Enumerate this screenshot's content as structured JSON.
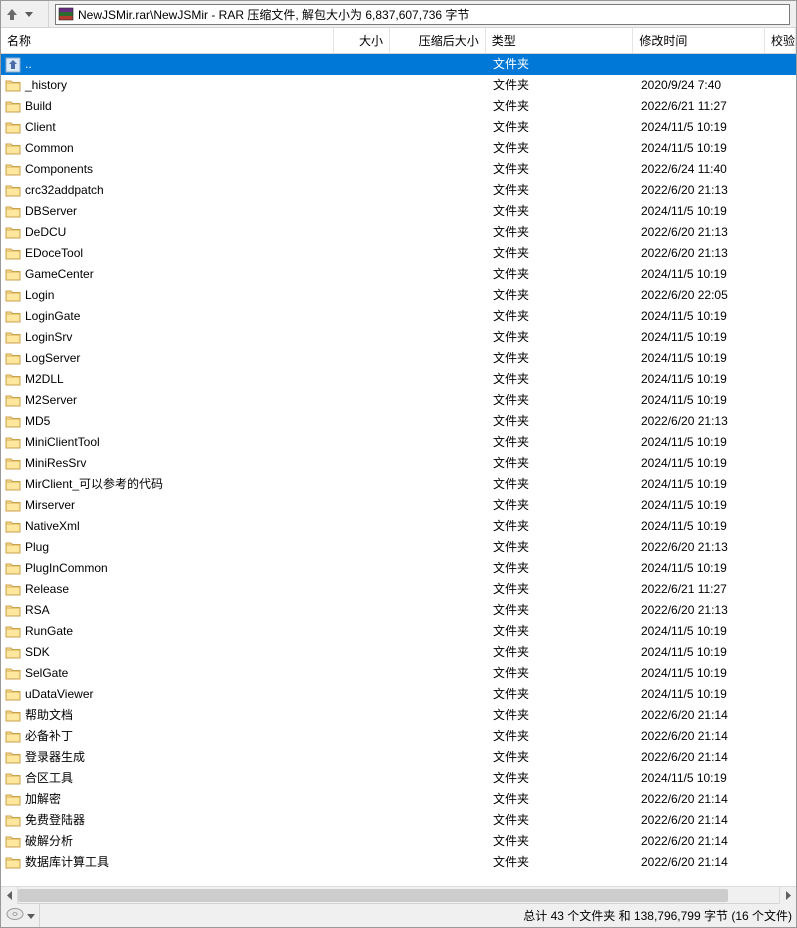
{
  "path": {
    "text": "NewJSMir.rar\\NewJSMir - RAR 压缩文件, 解包大小为 6,837,607,736 字节"
  },
  "columns": {
    "name": "名称",
    "size": "大小",
    "packed": "压缩后大小",
    "type": "类型",
    "mtime": "修改时间",
    "crc": "校验"
  },
  "parent_row": {
    "name": "..",
    "type": "文件夹"
  },
  "rows": [
    {
      "name": "_history",
      "type": "文件夹",
      "mtime": "2020/9/24 7:40"
    },
    {
      "name": "Build",
      "type": "文件夹",
      "mtime": "2022/6/21 11:27"
    },
    {
      "name": "Client",
      "type": "文件夹",
      "mtime": "2024/11/5 10:19"
    },
    {
      "name": "Common",
      "type": "文件夹",
      "mtime": "2024/11/5 10:19"
    },
    {
      "name": "Components",
      "type": "文件夹",
      "mtime": "2022/6/24 11:40"
    },
    {
      "name": "crc32addpatch",
      "type": "文件夹",
      "mtime": "2022/6/20 21:13"
    },
    {
      "name": "DBServer",
      "type": "文件夹",
      "mtime": "2024/11/5 10:19"
    },
    {
      "name": "DeDCU",
      "type": "文件夹",
      "mtime": "2022/6/20 21:13"
    },
    {
      "name": "EDoceTool",
      "type": "文件夹",
      "mtime": "2022/6/20 21:13"
    },
    {
      "name": "GameCenter",
      "type": "文件夹",
      "mtime": "2024/11/5 10:19"
    },
    {
      "name": "Login",
      "type": "文件夹",
      "mtime": "2022/6/20 22:05"
    },
    {
      "name": "LoginGate",
      "type": "文件夹",
      "mtime": "2024/11/5 10:19"
    },
    {
      "name": "LoginSrv",
      "type": "文件夹",
      "mtime": "2024/11/5 10:19"
    },
    {
      "name": "LogServer",
      "type": "文件夹",
      "mtime": "2024/11/5 10:19"
    },
    {
      "name": "M2DLL",
      "type": "文件夹",
      "mtime": "2024/11/5 10:19"
    },
    {
      "name": "M2Server",
      "type": "文件夹",
      "mtime": "2024/11/5 10:19"
    },
    {
      "name": "MD5",
      "type": "文件夹",
      "mtime": "2022/6/20 21:13"
    },
    {
      "name": "MiniClientTool",
      "type": "文件夹",
      "mtime": "2024/11/5 10:19"
    },
    {
      "name": "MiniResSrv",
      "type": "文件夹",
      "mtime": "2024/11/5 10:19"
    },
    {
      "name": "MirClient_可以参考的代码",
      "type": "文件夹",
      "mtime": "2024/11/5 10:19"
    },
    {
      "name": "Mirserver",
      "type": "文件夹",
      "mtime": "2024/11/5 10:19"
    },
    {
      "name": "NativeXml",
      "type": "文件夹",
      "mtime": "2024/11/5 10:19"
    },
    {
      "name": "Plug",
      "type": "文件夹",
      "mtime": "2022/6/20 21:13"
    },
    {
      "name": "PlugInCommon",
      "type": "文件夹",
      "mtime": "2024/11/5 10:19"
    },
    {
      "name": "Release",
      "type": "文件夹",
      "mtime": "2022/6/21 11:27"
    },
    {
      "name": "RSA",
      "type": "文件夹",
      "mtime": "2022/6/20 21:13"
    },
    {
      "name": "RunGate",
      "type": "文件夹",
      "mtime": "2024/11/5 10:19"
    },
    {
      "name": "SDK",
      "type": "文件夹",
      "mtime": "2024/11/5 10:19"
    },
    {
      "name": "SelGate",
      "type": "文件夹",
      "mtime": "2024/11/5 10:19"
    },
    {
      "name": "uDataViewer",
      "type": "文件夹",
      "mtime": "2024/11/5 10:19"
    },
    {
      "name": "帮助文档",
      "type": "文件夹",
      "mtime": "2022/6/20 21:14"
    },
    {
      "name": "必备补丁",
      "type": "文件夹",
      "mtime": "2022/6/20 21:14"
    },
    {
      "name": "登录器生成",
      "type": "文件夹",
      "mtime": "2022/6/20 21:14"
    },
    {
      "name": "合区工具",
      "type": "文件夹",
      "mtime": "2024/11/5 10:19"
    },
    {
      "name": "加解密",
      "type": "文件夹",
      "mtime": "2022/6/20 21:14"
    },
    {
      "name": "免费登陆器",
      "type": "文件夹",
      "mtime": "2022/6/20 21:14"
    },
    {
      "name": "破解分析",
      "type": "文件夹",
      "mtime": "2022/6/20 21:14"
    },
    {
      "name": "数据库计算工具",
      "type": "文件夹",
      "mtime": "2022/6/20 21:14"
    }
  ],
  "status": {
    "summary": "总计 43 个文件夹 和 138,796,799 字节 (16 个文件)"
  }
}
